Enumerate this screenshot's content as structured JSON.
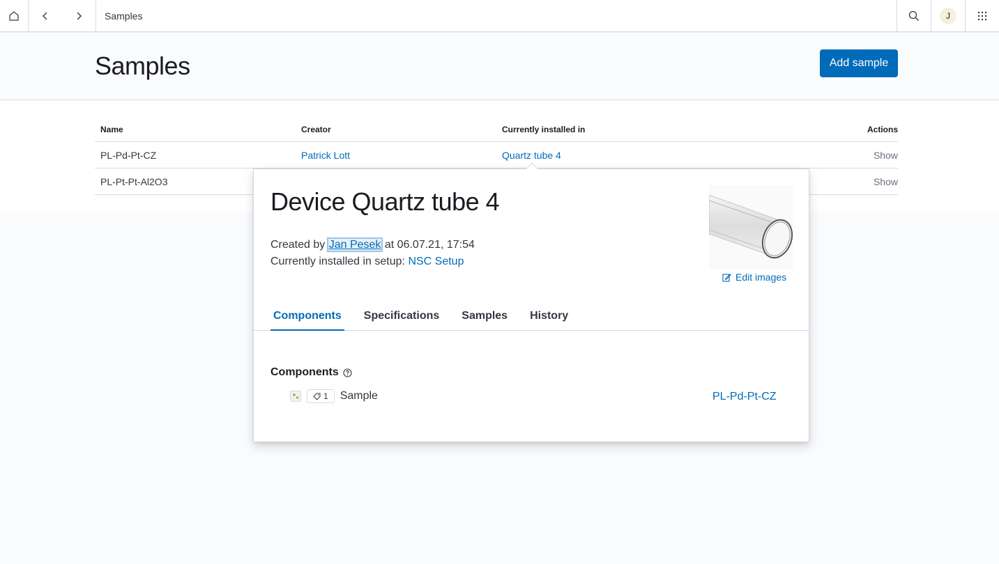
{
  "topbar": {
    "breadcrumb": "Samples",
    "avatar_initial": "J",
    "icons": [
      "home-icon",
      "chevron-left-icon",
      "chevron-right-icon",
      "search-icon",
      "apps-grid-icon"
    ]
  },
  "header": {
    "title": "Samples",
    "add_button": "Add sample"
  },
  "table": {
    "columns": [
      "Name",
      "Creator",
      "Currently installed in",
      "Actions"
    ],
    "rows": [
      {
        "name": "PL-Pd-Pt-CZ",
        "creator": "Patrick Lott",
        "installed_in": "Quartz tube 4",
        "action": "Show"
      },
      {
        "name": "PL-Pt-Pt-Al2O3",
        "creator": "",
        "installed_in": "",
        "action": "Show"
      }
    ]
  },
  "popover": {
    "title": "Device Quartz tube 4",
    "created_by_prefix": "Created by",
    "creator": "Jan Pesek",
    "created_at": "at 06.07.21, 17:54",
    "installed_prefix": "Currently installed in setup:",
    "setup": "NSC Setup",
    "edit_images": "Edit images",
    "tabs": [
      "Components",
      "Specifications",
      "Samples",
      "History"
    ],
    "active_tab": "Components",
    "components_title": "Components",
    "component": {
      "badge_count": "1",
      "label": "Sample",
      "link": "PL-Pd-Pt-CZ"
    }
  },
  "colors": {
    "accent": "#006bb8",
    "text": "#1a1c21",
    "border": "#d3dae6"
  }
}
